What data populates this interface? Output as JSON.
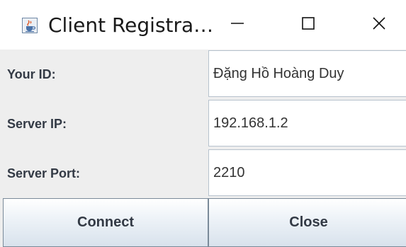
{
  "window": {
    "title": "Client Registra…",
    "icon": "java-cup-icon",
    "controls": [
      "minimize-icon",
      "maximize-icon",
      "close-icon"
    ]
  },
  "form": {
    "your_id": {
      "label": "Your ID:",
      "value": "Đặng Hồ Hoàng Duy"
    },
    "server_ip": {
      "label": "Server IP:",
      "value": "192.168.1.2"
    },
    "server_port": {
      "label": "Server Port:",
      "value": "2210"
    }
  },
  "buttons": {
    "connect": "Connect",
    "close": "Close"
  }
}
